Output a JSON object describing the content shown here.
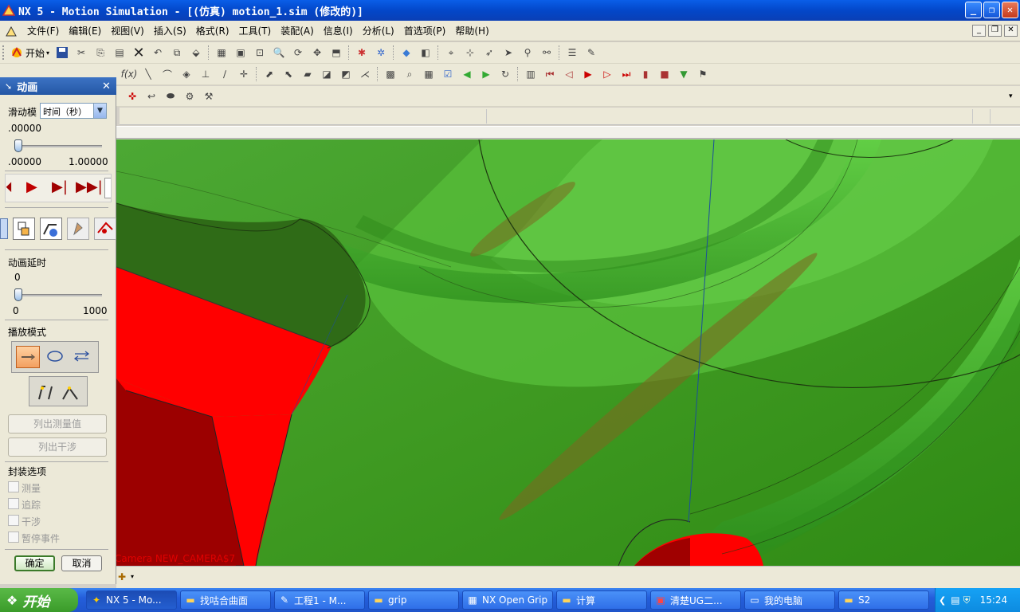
{
  "window": {
    "title": "NX 5 - Motion Simulation - [(仿真) motion_1.sim (修改的)]",
    "minimize": "_",
    "restore": "❐",
    "close": "✕"
  },
  "menu": {
    "items": [
      "文件(F)",
      "编辑(E)",
      "视图(V)",
      "插入(S)",
      "格式(R)",
      "工具(T)",
      "装配(A)",
      "信息(I)",
      "分析(L)",
      "首选项(P)",
      "帮助(H)"
    ]
  },
  "toolbar": {
    "start_label": "开始"
  },
  "panel": {
    "title": "动画",
    "slider_mode_label": "滑动模",
    "slider_mode_value": "时间（秒）",
    "time_current": ".00000",
    "time_min": ".00000",
    "time_max": "1.00000",
    "time_fraction": 0.0,
    "delay_label": "动画延时",
    "delay_current": "0",
    "delay_min": "0",
    "delay_max": "1000",
    "delay_fraction": 0.0,
    "play_mode_label": "播放模式",
    "list_measure_label": "列出测量值",
    "list_interference_label": "列出干涉",
    "package_label": "封装选项",
    "options": [
      "测量",
      "追踪",
      "干涉",
      "暂停事件"
    ],
    "ok_label": "确定",
    "cancel_label": "取消"
  },
  "viewport": {
    "camera_label": "Camera NEW_CAMERA$7"
  },
  "colors": {
    "green_main": "#43a627",
    "red": "#ff0000",
    "dark_red": "#9c0000",
    "title_blue": "#0347c9"
  },
  "taskbar": {
    "start_label": "开始",
    "tasks": [
      "NX 5 - Mo...",
      "找咕合曲面",
      "工程1 - M...",
      "grip",
      "NX Open Grip",
      "计算",
      "清楚UG二...",
      "我的电脑",
      "S2"
    ],
    "clock": "15:24"
  }
}
